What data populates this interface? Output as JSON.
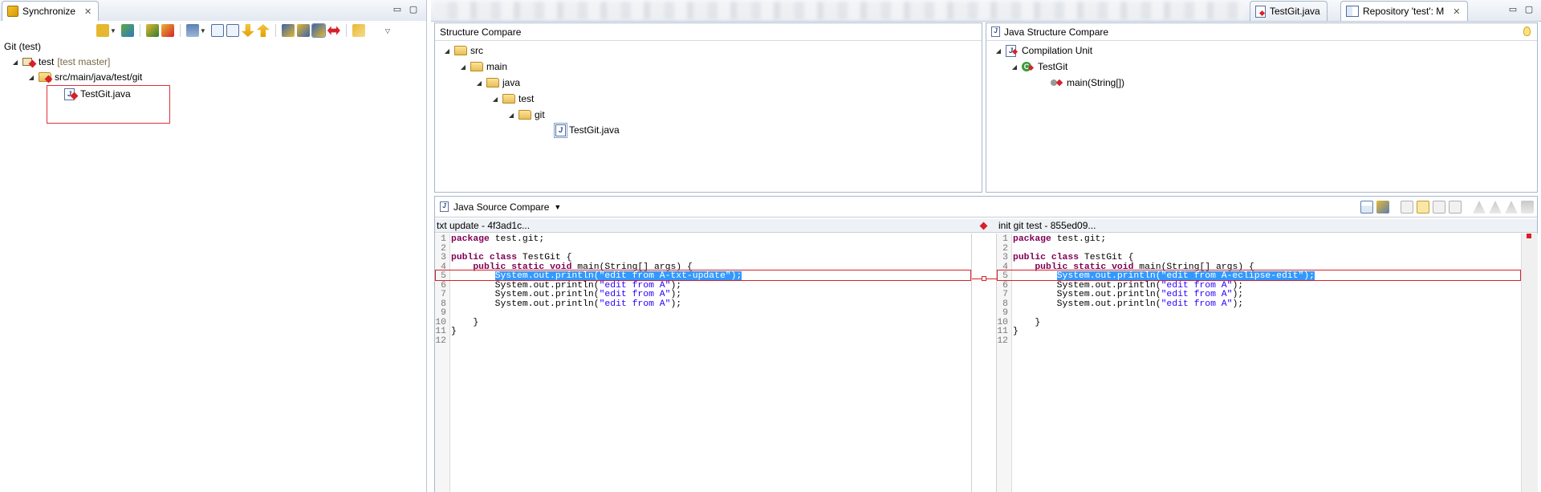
{
  "sync_view": {
    "tab_title": "Synchronize",
    "tab_close": "✕",
    "git_label": "Git (test)",
    "tree": [
      {
        "label": "test",
        "annotation": "[test master]"
      },
      {
        "label": "src/main/java/test/git"
      },
      {
        "label": "TestGit.java"
      }
    ]
  },
  "editor_tabs": [
    {
      "label": "TestGit.java"
    },
    {
      "label": "Repository 'test': M"
    }
  ],
  "structure_compare": {
    "title": "Structure Compare",
    "tree": [
      "src",
      "main",
      "java",
      "test",
      "git",
      "TestGit.java"
    ]
  },
  "java_structure": {
    "title": "Java Structure Compare",
    "tree": [
      "Compilation Unit",
      "TestGit",
      "main(String[])"
    ]
  },
  "source_compare": {
    "title": "Java Source Compare",
    "left_header": "txt update - 4f3ad1c...",
    "right_header": "init git test - 855ed09...",
    "left_lines": [
      {
        "n": "1",
        "code": "package test.git;"
      },
      {
        "n": "2",
        "code": ""
      },
      {
        "n": "3",
        "code": "public class TestGit {"
      },
      {
        "n": "4",
        "code": "    public static void main(String[] args) {"
      },
      {
        "n": "5",
        "code": "        System.out.println(\"edit from A-txt-update\");"
      },
      {
        "n": "6",
        "code": "        System.out.println(\"edit from A\");"
      },
      {
        "n": "7",
        "code": "        System.out.println(\"edit from A\");"
      },
      {
        "n": "8",
        "code": "        System.out.println(\"edit from A\");"
      },
      {
        "n": "9",
        "code": ""
      },
      {
        "n": "10",
        "code": "    }"
      },
      {
        "n": "11",
        "code": "}"
      },
      {
        "n": "12",
        "code": ""
      }
    ],
    "right_lines": [
      {
        "n": "1",
        "code": "package test.git;"
      },
      {
        "n": "2",
        "code": ""
      },
      {
        "n": "3",
        "code": "public class TestGit {"
      },
      {
        "n": "4",
        "code": "    public static void main(String[] args) {"
      },
      {
        "n": "5",
        "code": "        System.out.println(\"edit from A-eclipse-edit\");"
      },
      {
        "n": "6",
        "code": "        System.out.println(\"edit from A\");"
      },
      {
        "n": "7",
        "code": "        System.out.println(\"edit from A\");"
      },
      {
        "n": "8",
        "code": "        System.out.println(\"edit from A\");"
      },
      {
        "n": "9",
        "code": ""
      },
      {
        "n": "10",
        "code": "    }"
      },
      {
        "n": "11",
        "code": "}"
      },
      {
        "n": "12",
        "code": ""
      }
    ],
    "changed_line": 5
  },
  "colors": {
    "selection": "#3399ff",
    "diff_marker": "#d8202a",
    "keyword": "#7f0055",
    "string": "#2a00ff"
  }
}
